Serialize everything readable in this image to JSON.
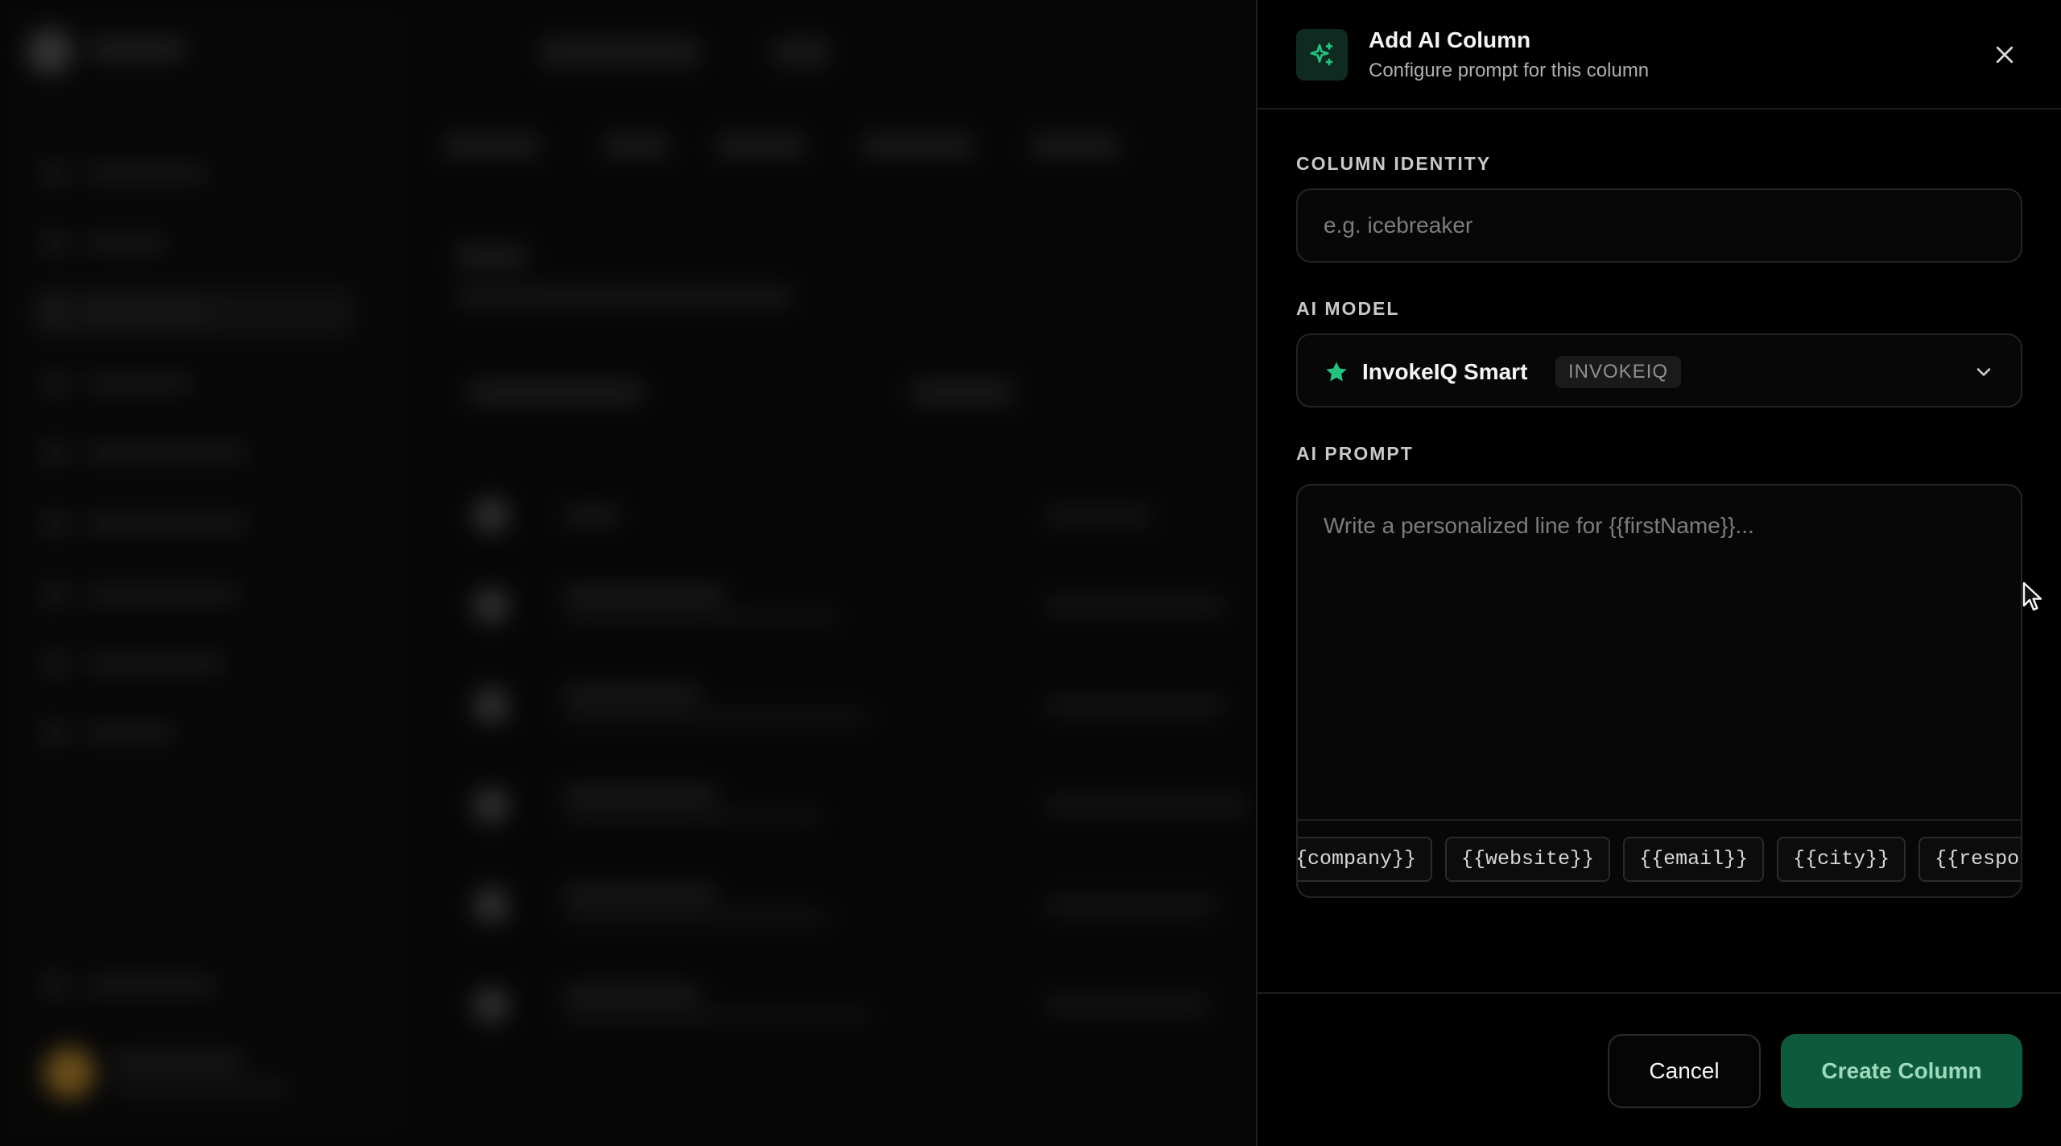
{
  "panel": {
    "icon": "sparkles-icon",
    "title": "Add AI Column",
    "subtitle": "Configure prompt for this column",
    "close_icon": "close-icon"
  },
  "column_identity": {
    "label": "COLUMN IDENTITY",
    "value": "",
    "placeholder": "e.g. icebreaker"
  },
  "ai_model": {
    "label": "AI MODEL",
    "icon": "star-icon",
    "selected_name": "InvokeIQ Smart",
    "selected_badge": "INVOKEIQ",
    "dropdown_icon": "chevron-down-icon"
  },
  "ai_prompt": {
    "label": "AI PROMPT",
    "value": "",
    "placeholder": "Write a personalized line for {{firstName}}...",
    "variables": [
      "{{company}}",
      "{{website}}",
      "{{email}}",
      "{{city}}",
      "{{response}}"
    ]
  },
  "footer": {
    "cancel_label": "Cancel",
    "create_label": "Create Column"
  },
  "colors": {
    "accent_green": "#22c47e",
    "create_button_bg": "#0e5a3d",
    "create_button_text": "#9dd9bd",
    "panel_bg": "#000000"
  }
}
